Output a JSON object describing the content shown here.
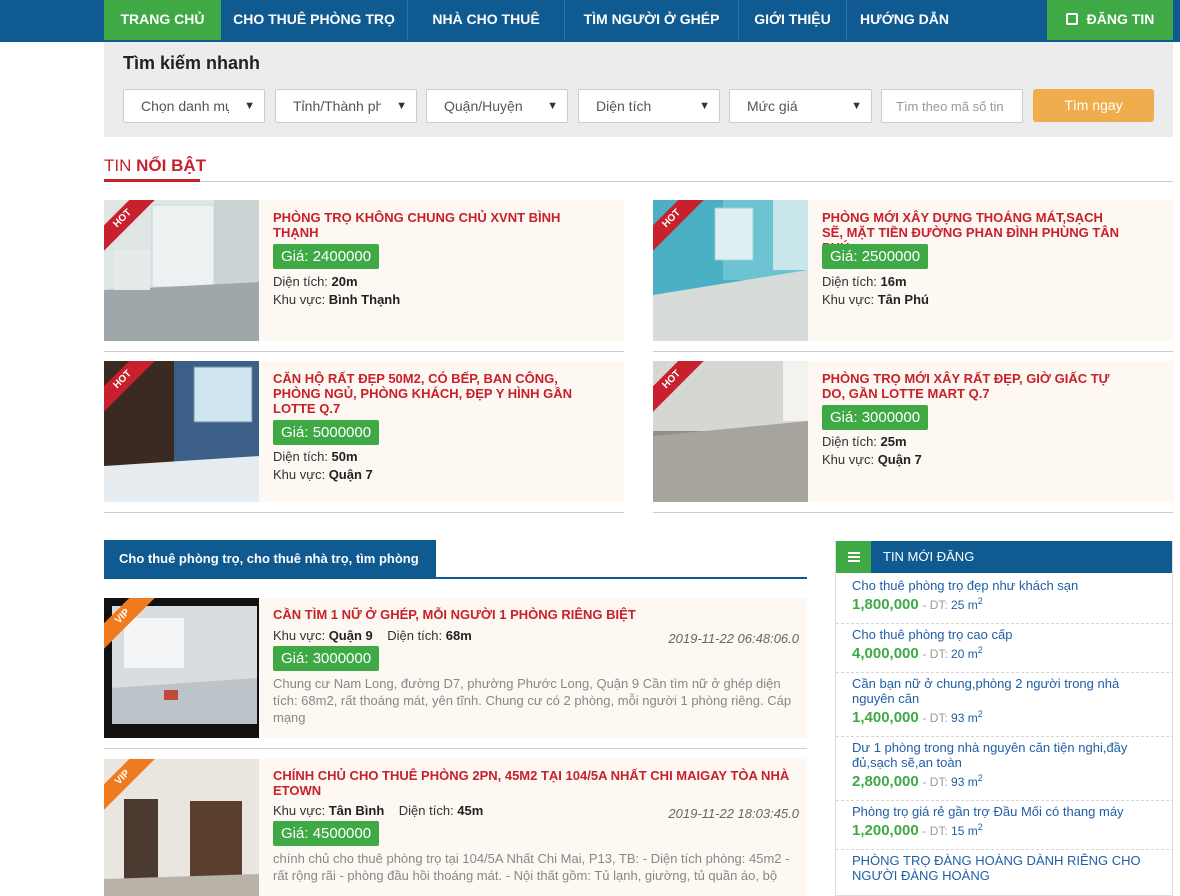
{
  "nav": {
    "items": [
      {
        "label": "TRANG CHỦ"
      },
      {
        "label": "CHO THUÊ PHÒNG TRỌ"
      },
      {
        "label": "NHÀ CHO THUÊ"
      },
      {
        "label": "TÌM NGƯỜI Ở GHÉP"
      },
      {
        "label": "GIỚI THIỆU"
      },
      {
        "label": "HƯỚNG DẪN"
      }
    ],
    "post_label": "ĐĂNG TIN",
    "colors": {
      "primary": "#0f5a91",
      "accent": "#3fa945"
    }
  },
  "search": {
    "title": "Tìm kiếm nhanh",
    "selects": [
      "Chọn danh mục",
      "Tỉnh/Thành phố",
      "Quận/Huyện",
      "Diện tích",
      "Mức giá"
    ],
    "code_placeholder": "Tìm theo mã số tin",
    "button": "Tìm ngay"
  },
  "featured": {
    "title_prefix": "TIN",
    "title_main": "NỔI BẬT",
    "badge": "HOT",
    "price_prefix": "Giá:",
    "area_label": "Diện tích:",
    "region_label": "Khu vực:",
    "items": [
      {
        "title": "PHÒNG TRỌ KHÔNG CHUNG CHỦ XVNT BÌNH THẠNH",
        "price": "2400000",
        "area": "20m",
        "region": "Bình Thạnh"
      },
      {
        "title": "PHÒNG MỚI XÂY DỰNG THOÁNG MÁT,SẠCH SẼ, MẶT TIỀN ĐƯỜNG PHAN ĐÌNH PHÙNG TÂN PHÚ",
        "price": "2500000",
        "area": "16m",
        "region": "Tân Phú"
      },
      {
        "title": "CĂN HỘ RẤT ĐẸP 50M2, CÓ BẾP, BAN CÔNG, PHÒNG NGỦ, PHÒNG KHÁCH, ĐẸP Y HÌNH GẦN LOTTE Q.7",
        "price": "5000000",
        "area": "50m",
        "region": "Quận 7"
      },
      {
        "title": "PHÒNG TRỌ MỚI XÂY RẤT ĐẸP, GIỜ GIẤC TỰ DO, GẦN LOTTE MART Q.7",
        "price": "3000000",
        "area": "25m",
        "region": "Quận 7"
      }
    ]
  },
  "listing": {
    "tab": "Cho thuê phòng trọ, cho thuê nhà trọ, tìm phòng trọ",
    "badge": "VIP",
    "region_label": "Khu vực:",
    "area_label": "Diện tích:",
    "price_prefix": "Giá:",
    "items": [
      {
        "title": "CẦN TÌM 1 NỮ Ở GHÉP, MỖI NGƯỜI 1 PHÒNG RIÊNG BIỆT",
        "region": "Quận 9",
        "area": "68m",
        "date": "2019-11-22 06:48:06.0",
        "price": "3000000",
        "desc": "Chung cư Nam Long, đường D7, phường Phước Long, Quận 9 Cần tìm nữ ở ghép diện tích: 68m2, rất thoáng mát, yên tĩnh. Chung cư có 2 phòng, mỗi người 1 phòng riêng. Cáp mạng"
      },
      {
        "title": "CHÍNH CHỦ CHO THUÊ PHÒNG 2PN, 45M2 TẠI 104/5A NHẤT CHI MAIGAY TÒA NHÀ ETOWN",
        "region": "Tân Bình",
        "area": "45m",
        "date": "2019-11-22 18:03:45.0",
        "price": "4500000",
        "desc": "chính chủ cho thuê phòng trọ tại 104/5A Nhất Chi Mai, P13, TB: - Diện tích phòng: 45m2 - rất rộng rãi - phòng đầu hồi thoáng mát. - Nội thất gồm: Tủ lạnh, giường, tủ quần áo, bộ"
      }
    ]
  },
  "sidebar": {
    "title": "TIN MỚI ĐĂNG",
    "dt_label": "- DT:",
    "unit": "m",
    "unit_sup": "2",
    "items": [
      {
        "title": "Cho thuê phòng trọ đẹp như khách sạn",
        "price": "1,800,000",
        "area": "25"
      },
      {
        "title": "Cho thuê phòng trọ cao cấp",
        "price": "4,000,000",
        "area": "20"
      },
      {
        "title": "Cần bạn nữ ở chung,phòng 2 người trong nhà nguyên căn",
        "price": "1,400,000",
        "area": "93"
      },
      {
        "title": "Dư 1 phòng trong nhà nguyên căn tiện nghi,đầy đủ,sạch sẽ,an toàn",
        "price": "2,800,000",
        "area": "93"
      },
      {
        "title": "Phòng trọ giá rẻ gần trợ Đầu Mối có thang máy",
        "price": "1,200,000",
        "area": "15"
      },
      {
        "title": "PHÒNG TRỌ ĐÀNG HOÀNG DÀNH RIÊNG CHO NGƯỜI ĐÀNG HOÀNG"
      }
    ]
  }
}
